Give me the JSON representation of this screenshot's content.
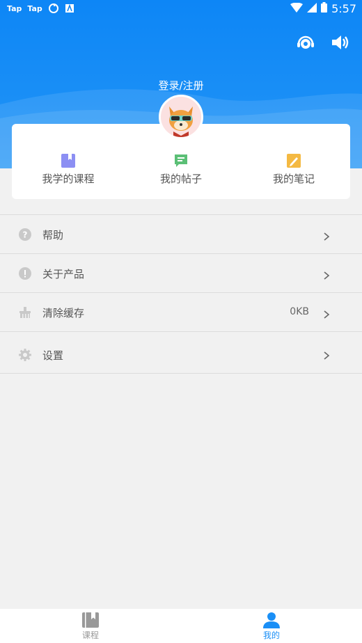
{
  "status_bar": {
    "left_items": [
      "Tap",
      "Tap"
    ],
    "time": "5:57"
  },
  "header": {
    "login_label": "登录/注册"
  },
  "quick_links": [
    {
      "label": "我学的课程",
      "icon": "book-icon",
      "color": "#8c8ff3"
    },
    {
      "label": "我的帖子",
      "icon": "chat-icon",
      "color": "#5bbf76"
    },
    {
      "label": "我的笔记",
      "icon": "note-icon",
      "color": "#f4b942"
    }
  ],
  "menu": [
    {
      "label": "帮助",
      "icon": "help-icon",
      "value": ""
    },
    {
      "label": "关于产品",
      "icon": "info-icon",
      "value": ""
    },
    {
      "label": "清除缓存",
      "icon": "broom-icon",
      "value": "0KB"
    },
    {
      "label": "设置",
      "icon": "gear-icon",
      "value": ""
    }
  ],
  "bottom_nav": {
    "tabs": [
      {
        "label": "课程",
        "icon": "book-icon",
        "active": false
      },
      {
        "label": "我的",
        "icon": "user-icon",
        "active": true
      }
    ]
  },
  "colors": {
    "primary": "#1a8ff6",
    "background": "#f1f1f1",
    "inactive": "#999999"
  }
}
